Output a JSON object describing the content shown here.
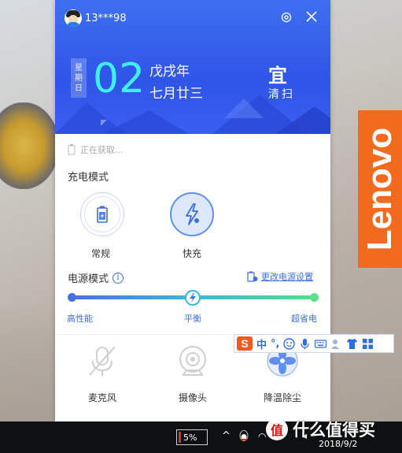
{
  "desktop": {
    "brand_text": "Lenovo"
  },
  "widget": {
    "user": {
      "name": "13***98"
    },
    "calendar": {
      "weekday_tag": [
        "星",
        "期",
        "日"
      ],
      "day": "02",
      "lunar_year": "戊戌年",
      "lunar_day": "七月廿三",
      "yi_label": "宜",
      "yi_activity": "清扫"
    },
    "battery_status": "正在获取...",
    "charge_mode": {
      "title": "充电模式",
      "options": [
        {
          "label": "常规",
          "selected": false
        },
        {
          "label": "快充",
          "selected": true
        }
      ]
    },
    "power_mode": {
      "title": "电源模式",
      "change_link": "更改电源设置",
      "level_fraction": 0.5,
      "labels": {
        "left": "高性能",
        "middle": "平衡",
        "right": "超省电"
      }
    },
    "tools": [
      {
        "label": "麦克风",
        "icon": "microphone-off-icon"
      },
      {
        "label": "摄像头",
        "icon": "camera-icon"
      },
      {
        "label": "降温除尘",
        "icon": "fan-icon"
      }
    ]
  },
  "ime_bar": {
    "logo": "S",
    "lang": "中",
    "punct": "°,"
  },
  "taskbar": {
    "battery_percent": "5%",
    "date": "2018/9/2",
    "watermark": "什么值得买",
    "watermark_badge": "值"
  },
  "colors": {
    "hero_blue": "#2f55e8",
    "accent_cyan": "#3ef0f0",
    "link_blue": "#3b6fe0",
    "lenovo_orange": "#f26a1e"
  }
}
